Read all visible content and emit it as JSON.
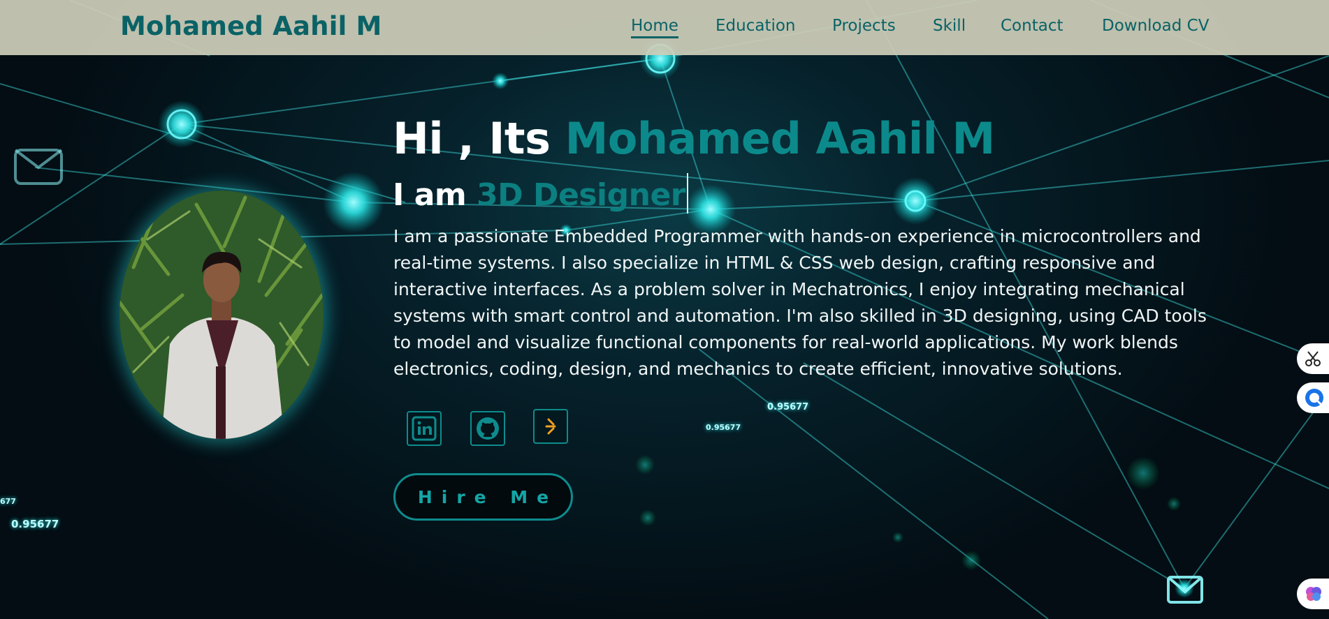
{
  "header": {
    "logo": "Mohamed Aahil M",
    "nav": [
      "Home",
      "Education",
      "Projects",
      "Skill",
      "Contact",
      "Download CV"
    ],
    "active": "Home"
  },
  "hero": {
    "greeting_prefix": "Hi , Its ",
    "greeting_name": "Mohamed Aahil M",
    "role_prefix": "I am ",
    "role_typed": "3D Designer",
    "bio": "I am a passionate Embedded Programmer with hands-on experience in microcontrollers and real-time systems. I also specialize in HTML & CSS web design, crafting responsive and interactive interfaces. As a problem solver in Mechatronics, I enjoy integrating mechanical systems with smart control and automation. I'm also skilled in 3D designing, using CAD tools to model and visualize functional components for real-world applications. My work blends electronics, coding, design, and mechanics to create efficient, innovative solutions.",
    "social": [
      {
        "icon": "linkedin-icon"
      },
      {
        "icon": "github-icon"
      },
      {
        "icon": "skillrack-icon"
      }
    ],
    "hire_label": "Hire Me"
  },
  "background_numbers": [
    "0.95677",
    "0.95677",
    "0.95677",
    "677"
  ],
  "colors": {
    "accent": "#0c8a8b",
    "header_bg": "#cdcdb9",
    "bg_dark": "#04121a"
  }
}
